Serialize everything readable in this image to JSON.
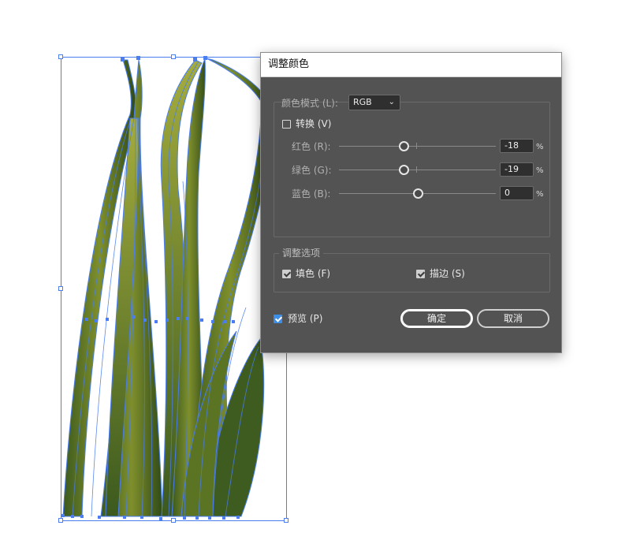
{
  "dialog": {
    "title": "调整颜色",
    "color_mode": {
      "label": "颜色模式 (L):",
      "value": "RGB"
    },
    "convert": {
      "label": "转换 (V)",
      "checked": false
    },
    "sliders": [
      {
        "label": "红色 (R):",
        "value": "-18",
        "unit": "%",
        "level": 0.41
      },
      {
        "label": "绿色 (G):",
        "value": "-19",
        "unit": "%",
        "level": 0.41
      },
      {
        "label": "蓝色 (B):",
        "value": "0",
        "unit": "%",
        "level": 0.5
      }
    ],
    "options_group": {
      "label": "调整选项",
      "fill": {
        "label": "填色 (F)",
        "checked": true
      },
      "stroke": {
        "label": "描边 (S)",
        "checked": true
      }
    },
    "preview": {
      "label": "预览 (P)",
      "checked": true
    },
    "ok_label": "确定",
    "cancel_label": "取消"
  },
  "colors": {
    "selection": "#4a7df0",
    "dialog_bg": "#535353",
    "grass_dark": "#3c5a1e",
    "grass_light": "#9aa43a",
    "preview_check": "#3d8ee6"
  },
  "artwork": {
    "subject": "grass-blades",
    "selected": true
  }
}
